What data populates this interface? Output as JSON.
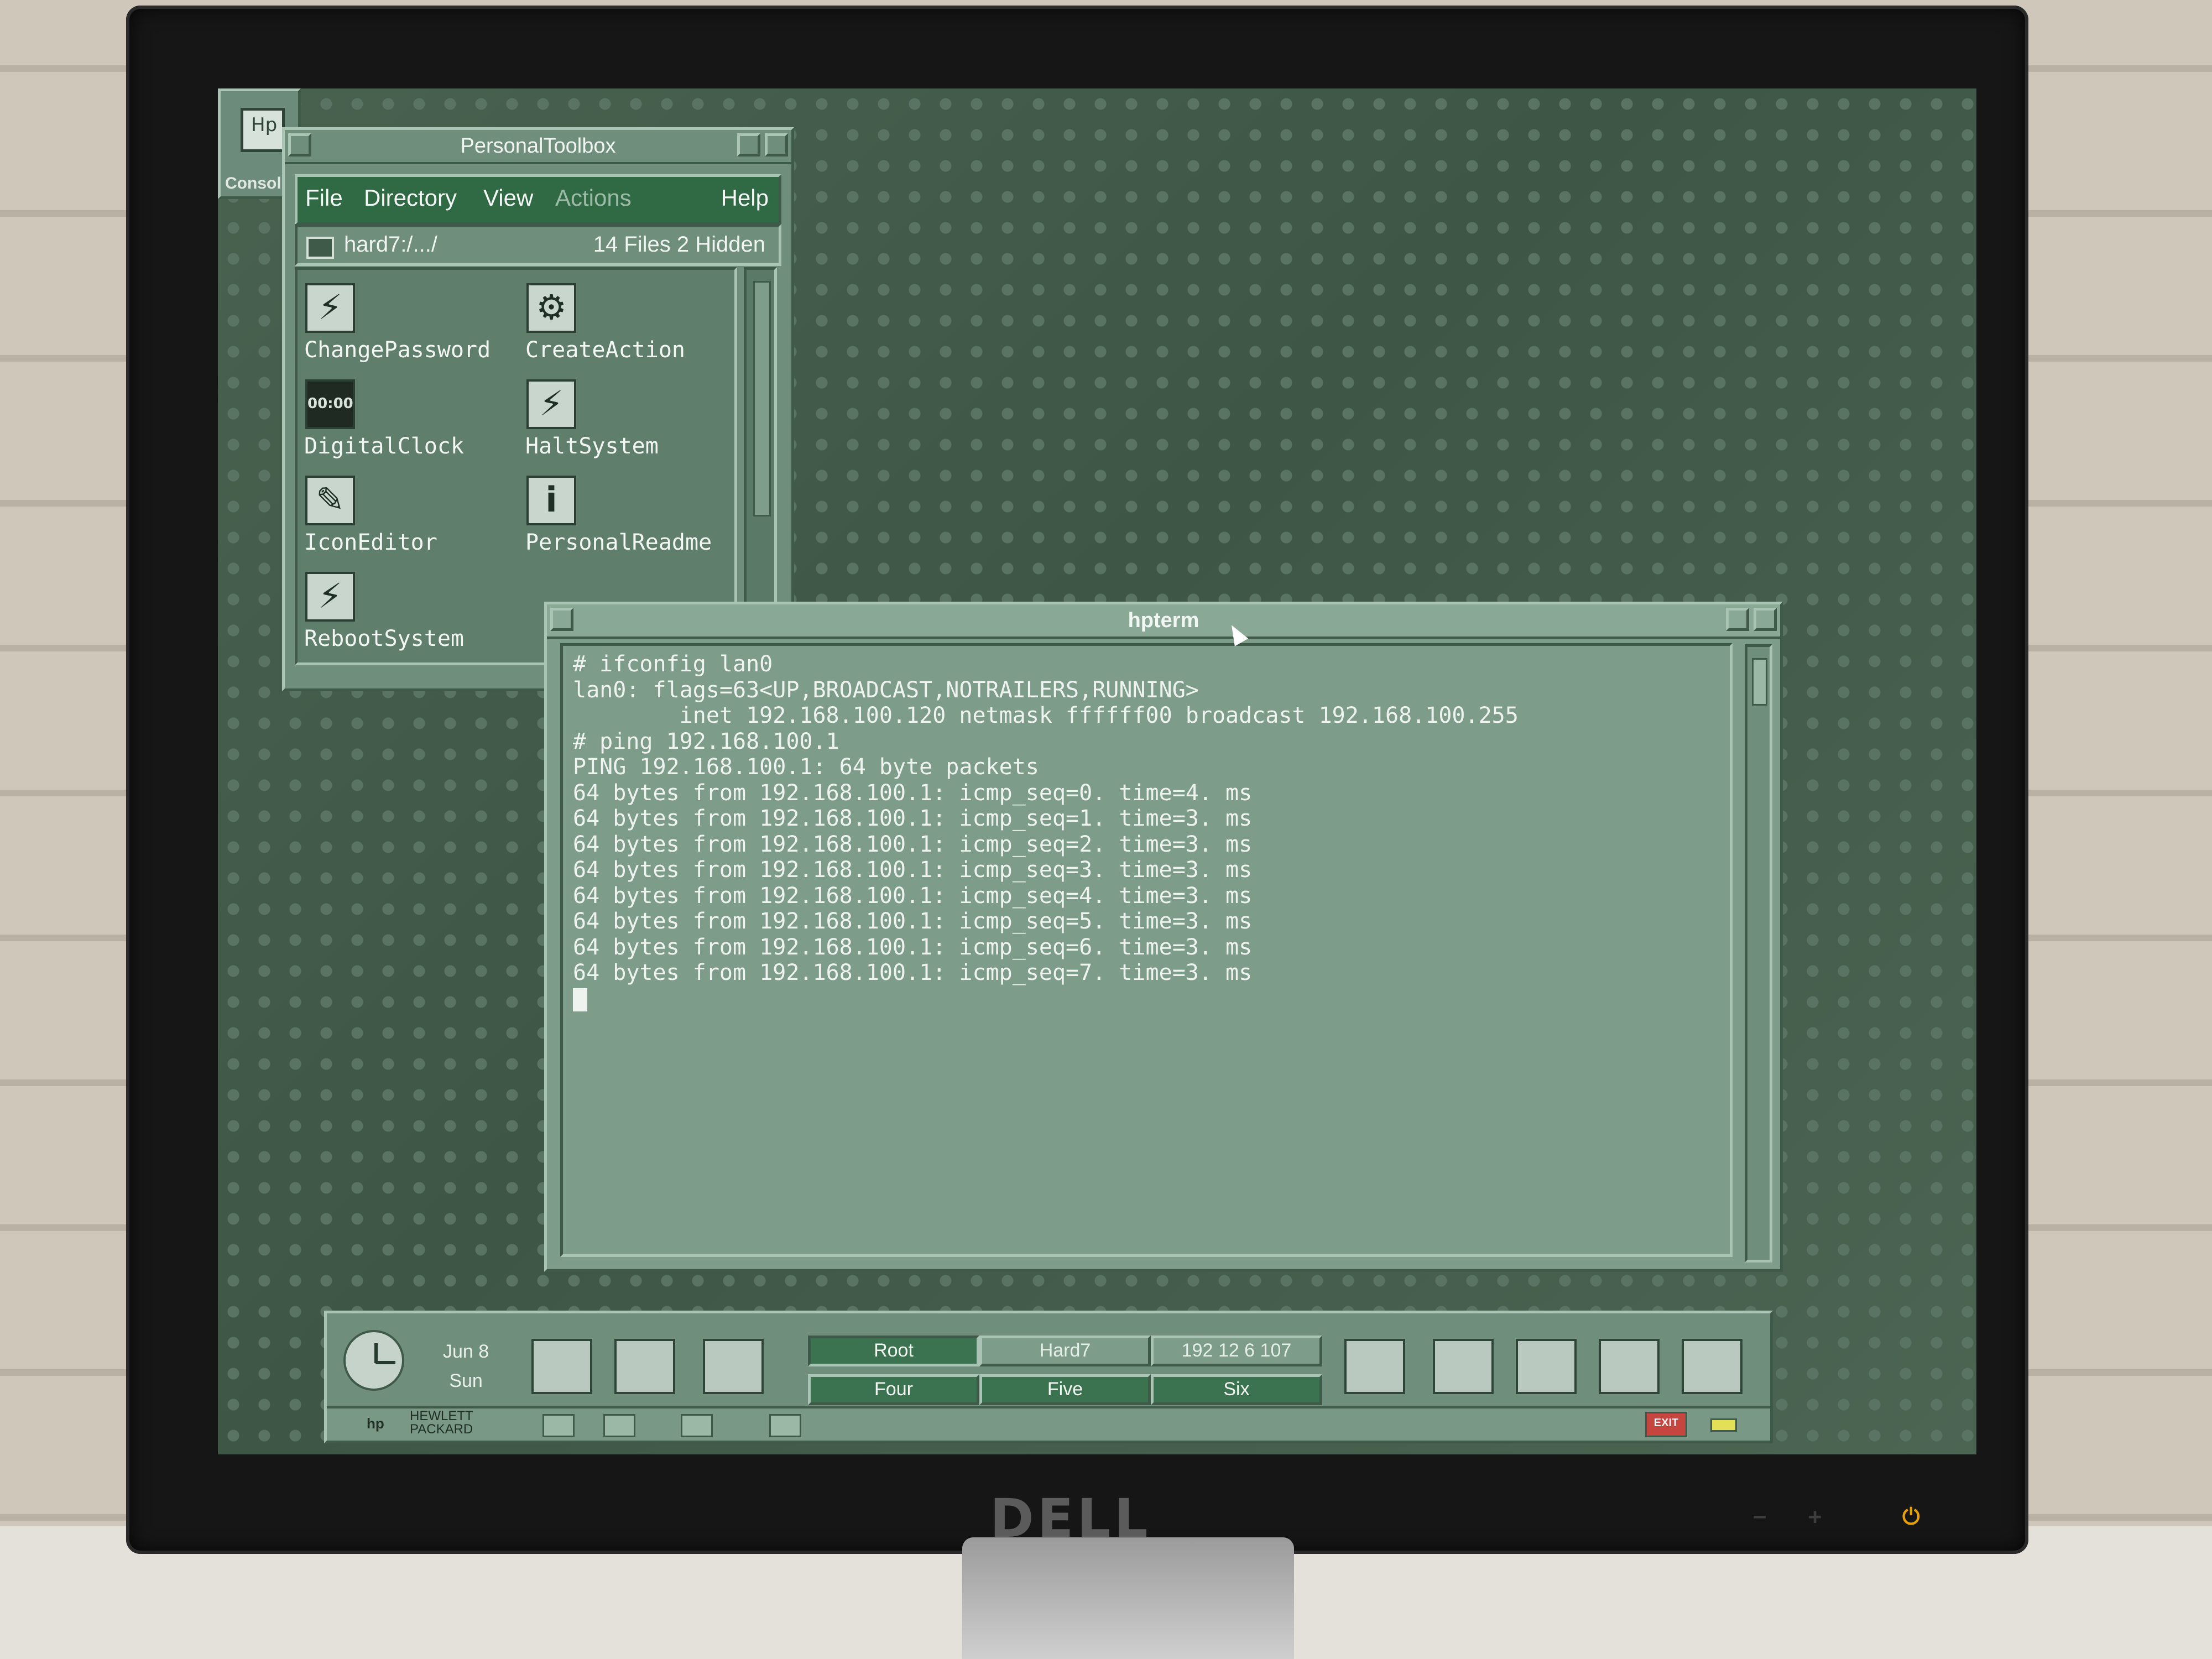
{
  "console": {
    "label": "Consol",
    "glyph": "Hp"
  },
  "toolbox": {
    "title": "PersonalToolbox",
    "menu": [
      "File",
      "Directory",
      "View",
      "Actions",
      "Help"
    ],
    "path": "hard7:/.../",
    "count": "14 Files 2 Hidden",
    "files": [
      {
        "label": "ChangePassword",
        "icon": "runner-icon"
      },
      {
        "label": "CreateAction",
        "icon": "action-icon"
      },
      {
        "label": "DigitalClock",
        "icon": "digital-clock-icon"
      },
      {
        "label": "HaltSystem",
        "icon": "runner-icon"
      },
      {
        "label": "IconEditor",
        "icon": "palette-icon"
      },
      {
        "label": "PersonalReadme",
        "icon": "info-icon"
      },
      {
        "label": "RebootSystem",
        "icon": "runner-icon"
      }
    ]
  },
  "terminal": {
    "title": "hpterm",
    "lines": [
      "# ifconfig lan0",
      "lan0: flags=63<UP,BROADCAST,NOTRAILERS,RUNNING>",
      "        inet 192.168.100.120 netmask ffffff00 broadcast 192.168.100.255",
      "# ping 192.168.100.1",
      "PING 192.168.100.1: 64 byte packets",
      "64 bytes from 192.168.100.1: icmp_seq=0. time=4. ms",
      "64 bytes from 192.168.100.1: icmp_seq=1. time=3. ms",
      "64 bytes from 192.168.100.1: icmp_seq=2. time=3. ms",
      "64 bytes from 192.168.100.1: icmp_seq=3. time=3. ms",
      "64 bytes from 192.168.100.1: icmp_seq=4. time=3. ms",
      "64 bytes from 192.168.100.1: icmp_seq=5. time=3. ms",
      "64 bytes from 192.168.100.1: icmp_seq=6. time=3. ms",
      "64 bytes from 192.168.100.1: icmp_seq=7. time=3. ms"
    ]
  },
  "frontpanel": {
    "date": "Jun 8",
    "day": "Sun",
    "workspaces": [
      "Root",
      "Hard7",
      "192 12 6 107",
      "Four",
      "Five",
      "Six"
    ],
    "active_workspace": "Root",
    "logo": "hp",
    "brand_line1": "HEWLETT",
    "brand_line2": "PACKARD",
    "exit_label": "EXIT"
  },
  "monitor": {
    "brand": "DELL"
  }
}
